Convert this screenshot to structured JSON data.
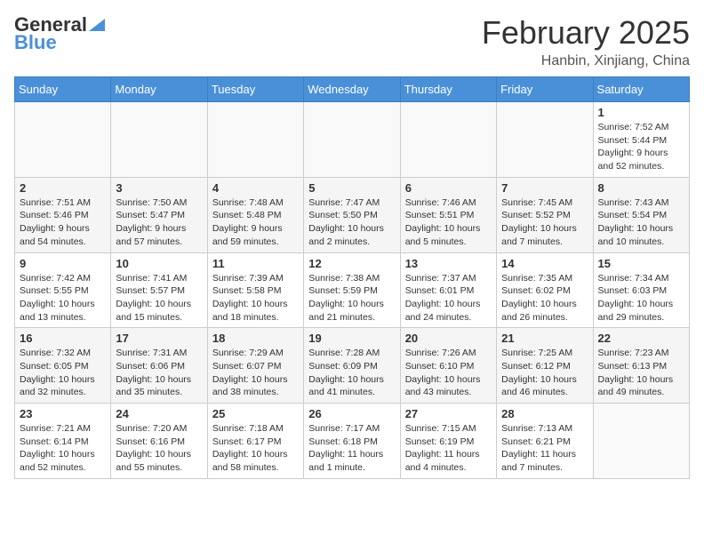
{
  "header": {
    "logo_line1": "General",
    "logo_line2": "Blue",
    "month": "February 2025",
    "location": "Hanbin, Xinjiang, China"
  },
  "weekdays": [
    "Sunday",
    "Monday",
    "Tuesday",
    "Wednesday",
    "Thursday",
    "Friday",
    "Saturday"
  ],
  "weeks": [
    [
      {
        "day": "",
        "info": ""
      },
      {
        "day": "",
        "info": ""
      },
      {
        "day": "",
        "info": ""
      },
      {
        "day": "",
        "info": ""
      },
      {
        "day": "",
        "info": ""
      },
      {
        "day": "",
        "info": ""
      },
      {
        "day": "1",
        "info": "Sunrise: 7:52 AM\nSunset: 5:44 PM\nDaylight: 9 hours and 52 minutes."
      }
    ],
    [
      {
        "day": "2",
        "info": "Sunrise: 7:51 AM\nSunset: 5:46 PM\nDaylight: 9 hours and 54 minutes."
      },
      {
        "day": "3",
        "info": "Sunrise: 7:50 AM\nSunset: 5:47 PM\nDaylight: 9 hours and 57 minutes."
      },
      {
        "day": "4",
        "info": "Sunrise: 7:48 AM\nSunset: 5:48 PM\nDaylight: 9 hours and 59 minutes."
      },
      {
        "day": "5",
        "info": "Sunrise: 7:47 AM\nSunset: 5:50 PM\nDaylight: 10 hours and 2 minutes."
      },
      {
        "day": "6",
        "info": "Sunrise: 7:46 AM\nSunset: 5:51 PM\nDaylight: 10 hours and 5 minutes."
      },
      {
        "day": "7",
        "info": "Sunrise: 7:45 AM\nSunset: 5:52 PM\nDaylight: 10 hours and 7 minutes."
      },
      {
        "day": "8",
        "info": "Sunrise: 7:43 AM\nSunset: 5:54 PM\nDaylight: 10 hours and 10 minutes."
      }
    ],
    [
      {
        "day": "9",
        "info": "Sunrise: 7:42 AM\nSunset: 5:55 PM\nDaylight: 10 hours and 13 minutes."
      },
      {
        "day": "10",
        "info": "Sunrise: 7:41 AM\nSunset: 5:57 PM\nDaylight: 10 hours and 15 minutes."
      },
      {
        "day": "11",
        "info": "Sunrise: 7:39 AM\nSunset: 5:58 PM\nDaylight: 10 hours and 18 minutes."
      },
      {
        "day": "12",
        "info": "Sunrise: 7:38 AM\nSunset: 5:59 PM\nDaylight: 10 hours and 21 minutes."
      },
      {
        "day": "13",
        "info": "Sunrise: 7:37 AM\nSunset: 6:01 PM\nDaylight: 10 hours and 24 minutes."
      },
      {
        "day": "14",
        "info": "Sunrise: 7:35 AM\nSunset: 6:02 PM\nDaylight: 10 hours and 26 minutes."
      },
      {
        "day": "15",
        "info": "Sunrise: 7:34 AM\nSunset: 6:03 PM\nDaylight: 10 hours and 29 minutes."
      }
    ],
    [
      {
        "day": "16",
        "info": "Sunrise: 7:32 AM\nSunset: 6:05 PM\nDaylight: 10 hours and 32 minutes."
      },
      {
        "day": "17",
        "info": "Sunrise: 7:31 AM\nSunset: 6:06 PM\nDaylight: 10 hours and 35 minutes."
      },
      {
        "day": "18",
        "info": "Sunrise: 7:29 AM\nSunset: 6:07 PM\nDaylight: 10 hours and 38 minutes."
      },
      {
        "day": "19",
        "info": "Sunrise: 7:28 AM\nSunset: 6:09 PM\nDaylight: 10 hours and 41 minutes."
      },
      {
        "day": "20",
        "info": "Sunrise: 7:26 AM\nSunset: 6:10 PM\nDaylight: 10 hours and 43 minutes."
      },
      {
        "day": "21",
        "info": "Sunrise: 7:25 AM\nSunset: 6:12 PM\nDaylight: 10 hours and 46 minutes."
      },
      {
        "day": "22",
        "info": "Sunrise: 7:23 AM\nSunset: 6:13 PM\nDaylight: 10 hours and 49 minutes."
      }
    ],
    [
      {
        "day": "23",
        "info": "Sunrise: 7:21 AM\nSunset: 6:14 PM\nDaylight: 10 hours and 52 minutes."
      },
      {
        "day": "24",
        "info": "Sunrise: 7:20 AM\nSunset: 6:16 PM\nDaylight: 10 hours and 55 minutes."
      },
      {
        "day": "25",
        "info": "Sunrise: 7:18 AM\nSunset: 6:17 PM\nDaylight: 10 hours and 58 minutes."
      },
      {
        "day": "26",
        "info": "Sunrise: 7:17 AM\nSunset: 6:18 PM\nDaylight: 11 hours and 1 minute."
      },
      {
        "day": "27",
        "info": "Sunrise: 7:15 AM\nSunset: 6:19 PM\nDaylight: 11 hours and 4 minutes."
      },
      {
        "day": "28",
        "info": "Sunrise: 7:13 AM\nSunset: 6:21 PM\nDaylight: 11 hours and 7 minutes."
      },
      {
        "day": "",
        "info": ""
      }
    ]
  ]
}
